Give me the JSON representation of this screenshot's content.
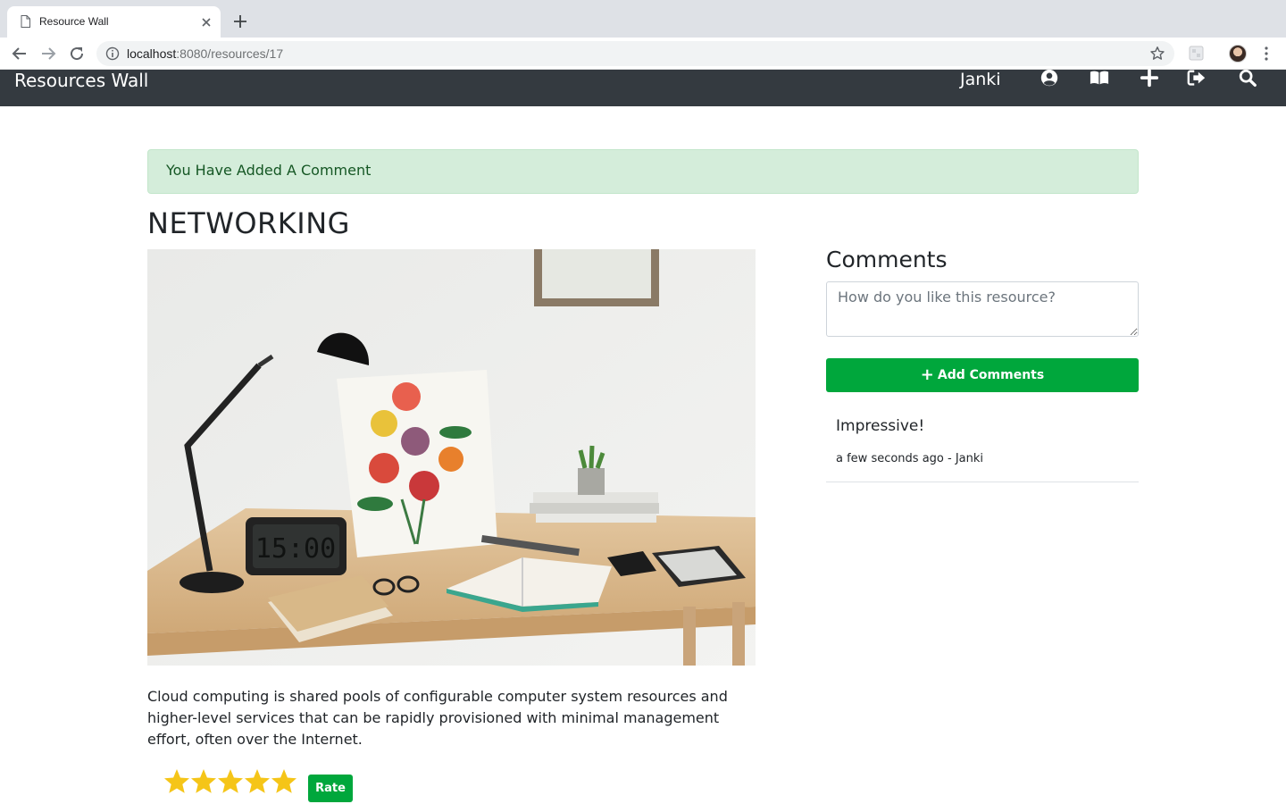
{
  "browser": {
    "tab_title": "Resource Wall",
    "url_host": "localhost",
    "url_path": ":8080/resources/17"
  },
  "navbar": {
    "brand": "Resources Wall",
    "username": "Janki",
    "icons": [
      "user-circle-icon",
      "book-open-icon",
      "plus-icon",
      "sign-out-icon",
      "search-icon"
    ]
  },
  "alert": {
    "message": "You Have Added A Comment",
    "color": "#d4edda"
  },
  "resource": {
    "title": "NETWORKING",
    "description": "Cloud computing is shared pools of configurable computer system resources and higher-level services that can be rapidly provisioned with minimal management effort, often over the Internet.",
    "rating": 5,
    "rating_max": 5,
    "rate_label": "Rate"
  },
  "comments": {
    "heading": "Comments",
    "placeholder": "How do you like this resource?",
    "add_label": "Add Comments",
    "items": [
      {
        "text": "Impressive!",
        "meta": "a few seconds ago - Janki"
      }
    ]
  },
  "colors": {
    "navbar": "#343a40",
    "accent_green": "#00a73c",
    "star": "#f5c518"
  }
}
